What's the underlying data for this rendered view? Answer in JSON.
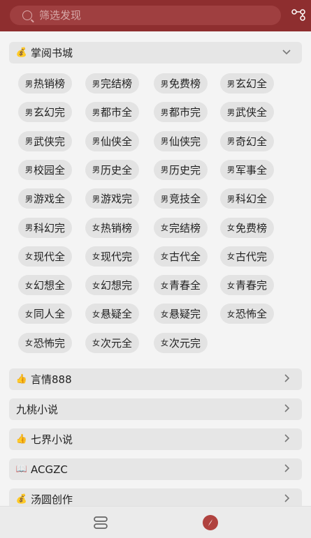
{
  "search": {
    "placeholder": "筛选发现"
  },
  "chips": [
    {
      "sym": "男",
      "text": "热销榜"
    },
    {
      "sym": "男",
      "text": "完结榜"
    },
    {
      "sym": "男",
      "text": "免费榜"
    },
    {
      "sym": "男",
      "text": "玄幻全"
    },
    {
      "sym": "男",
      "text": "玄幻完"
    },
    {
      "sym": "男",
      "text": "都市全"
    },
    {
      "sym": "男",
      "text": "都市完"
    },
    {
      "sym": "男",
      "text": "武侠全"
    },
    {
      "sym": "男",
      "text": "武侠完"
    },
    {
      "sym": "男",
      "text": "仙侠全"
    },
    {
      "sym": "男",
      "text": "仙侠完"
    },
    {
      "sym": "男",
      "text": "奇幻全"
    },
    {
      "sym": "男",
      "text": "校园全"
    },
    {
      "sym": "男",
      "text": "历史全"
    },
    {
      "sym": "男",
      "text": "历史完"
    },
    {
      "sym": "男",
      "text": "军事全"
    },
    {
      "sym": "男",
      "text": "游戏全"
    },
    {
      "sym": "男",
      "text": "游戏完"
    },
    {
      "sym": "男",
      "text": "竞技全"
    },
    {
      "sym": "男",
      "text": "科幻全"
    },
    {
      "sym": "男",
      "text": "科幻完"
    },
    {
      "sym": "女",
      "text": "热销榜"
    },
    {
      "sym": "女",
      "text": "完结榜"
    },
    {
      "sym": "女",
      "text": "免费榜"
    },
    {
      "sym": "女",
      "text": "现代全"
    },
    {
      "sym": "女",
      "text": "现代完"
    },
    {
      "sym": "女",
      "text": "古代全"
    },
    {
      "sym": "女",
      "text": "古代完"
    },
    {
      "sym": "女",
      "text": "幻想全"
    },
    {
      "sym": "女",
      "text": "幻想完"
    },
    {
      "sym": "女",
      "text": "青春全"
    },
    {
      "sym": "女",
      "text": "青春完"
    },
    {
      "sym": "女",
      "text": "同人全"
    },
    {
      "sym": "女",
      "text": "悬疑全"
    },
    {
      "sym": "女",
      "text": "悬疑完"
    },
    {
      "sym": "女",
      "text": "恐怖全"
    },
    {
      "sym": "女",
      "text": "恐怖完"
    },
    {
      "sym": "女",
      "text": "次元全"
    },
    {
      "sym": "女",
      "text": "次元完"
    }
  ],
  "sections": {
    "zhangyue": {
      "label": "掌阅书城",
      "icon": "money-bag-icon"
    },
    "yanqing": {
      "label": "言情888",
      "icon": "thumbs-up-icon"
    },
    "jiutao": {
      "label": "九桃小说"
    },
    "qijie": {
      "label": "七界小说",
      "icon": "thumbs-up-icon"
    },
    "acgzc": {
      "label": "ACGZC",
      "icon": "open-book-icon"
    },
    "tangyuan": {
      "label": "汤圆创作",
      "icon": "money-bag-icon"
    }
  },
  "nav": {
    "left": "shelf-icon",
    "right": "compass-icon"
  }
}
